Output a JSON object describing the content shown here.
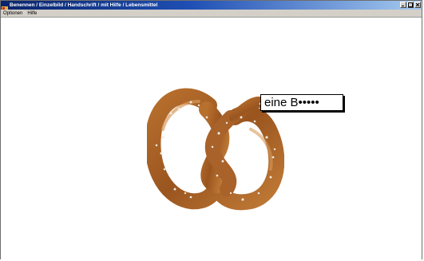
{
  "window": {
    "title": "Benennen / Einzelbild / Handschrift / mit Hilfe / Lebensmittel",
    "controls": [
      "minimize",
      "maximize",
      "close"
    ]
  },
  "menu": {
    "items": [
      {
        "label": "Optionen"
      },
      {
        "label": "Hilfe"
      }
    ]
  },
  "content": {
    "image": "pretzel",
    "answer_text": "eine B•••••"
  },
  "colors": {
    "titlebar_start": "#0a246a",
    "titlebar_end": "#a6caf0",
    "pretzel": "#a55f25"
  }
}
